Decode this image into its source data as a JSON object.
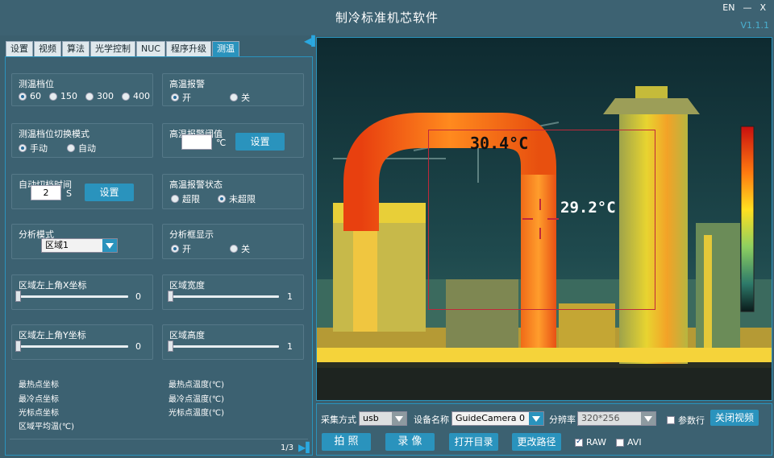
{
  "window": {
    "title": "制冷标准机芯软件",
    "lang_button": "EN",
    "minimize_glyph": "—",
    "close_glyph": "X",
    "version": "V1.1.1"
  },
  "tabs": [
    {
      "label": "设置",
      "active": false
    },
    {
      "label": "视频",
      "active": false
    },
    {
      "label": "算法",
      "active": false
    },
    {
      "label": "光学控制",
      "active": false
    },
    {
      "label": "NUC",
      "active": false
    },
    {
      "label": "程序升级",
      "active": false
    },
    {
      "label": "测温",
      "active": true
    }
  ],
  "temp_range": {
    "title": "测温档位",
    "options": [
      "60",
      "150",
      "300",
      "400"
    ],
    "selected": "60"
  },
  "high_temp_alarm": {
    "title": "高温报警",
    "options": [
      "开",
      "关"
    ],
    "selected": "开"
  },
  "range_switch_mode": {
    "title": "测温档位切换模式",
    "options": [
      "手动",
      "自动"
    ],
    "selected": "手动"
  },
  "alarm_threshold": {
    "title": "高温报警阈值",
    "value": "",
    "unit": "℃",
    "button": "设置"
  },
  "auto_switch_time": {
    "title": "自动切档时间",
    "value": "2",
    "unit": "S",
    "button": "设置"
  },
  "alarm_status": {
    "title": "高温报警状态",
    "options": [
      "超限",
      "未超限"
    ],
    "selected": "未超限"
  },
  "analysis_mode": {
    "title": "分析模式",
    "selected": "区域1"
  },
  "analysis_box": {
    "title": "分析框显示",
    "options": [
      "开",
      "关"
    ],
    "selected": "开"
  },
  "sliders": [
    {
      "title": "区域左上角X坐标",
      "value": "0"
    },
    {
      "title": "区域宽度",
      "value": "1"
    },
    {
      "title": "区域左上角Y坐标",
      "value": "0"
    },
    {
      "title": "区域高度",
      "value": "1"
    }
  ],
  "info": {
    "hot_point": "最热点坐标",
    "cold_point": "最冷点坐标",
    "cursor_point": "光标点坐标",
    "avg_temp": "区域平均温(℃)",
    "hot_temp": "最热点温度(℃)",
    "cold_temp": "最冷点温度(℃)",
    "cursor_temp": "光标点温度(℃)"
  },
  "pagination": {
    "text": "1/3"
  },
  "view": {
    "max_temp": "30.4°C",
    "cursor_temp": "29.2°C"
  },
  "controls": {
    "capture_mode_label": "采集方式",
    "capture_mode_value": "usb",
    "device_label": "设备名称",
    "device_value": "GuideCamera 0",
    "resolution_label": "分辨率",
    "resolution_value": "320*256",
    "param_row_label": "参数行",
    "param_row_checked": false,
    "close_video": "关闭视频",
    "photo": "拍 照",
    "record": "录 像",
    "open_dir": "打开目录",
    "change_path": "更改路径",
    "raw_label": "RAW",
    "raw_checked": true,
    "avi_label": "AVI",
    "avi_checked": false
  },
  "colors": {
    "accent": "#2a93bd",
    "panel": "#3c6171",
    "roi": "#c0283a"
  }
}
